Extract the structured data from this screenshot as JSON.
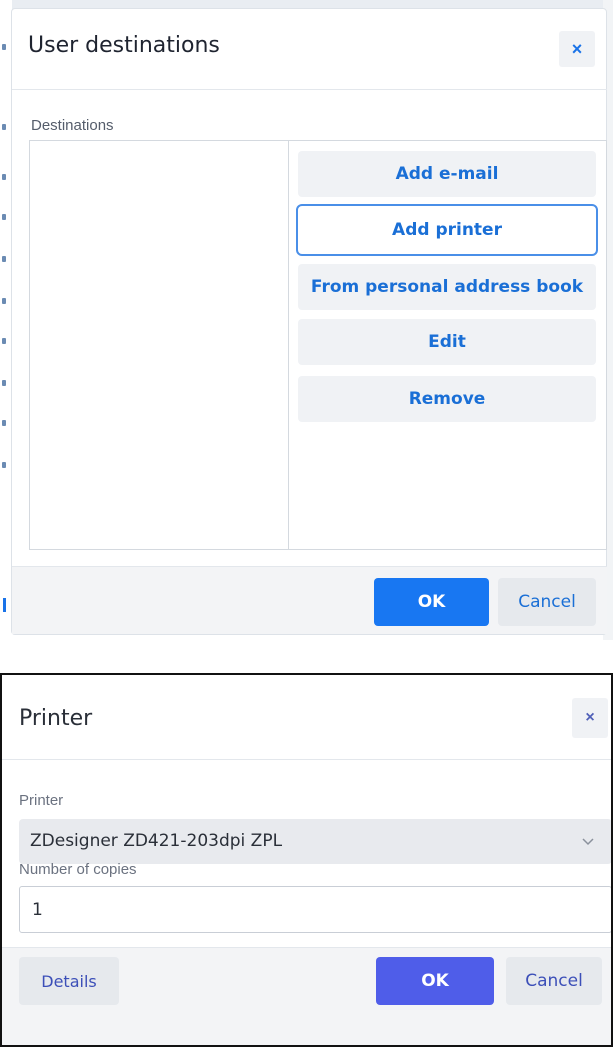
{
  "user_destinations_dialog": {
    "title": "User destinations",
    "close_glyph": "×",
    "destinations_label": "Destinations",
    "buttons": {
      "add_email": "Add e-mail",
      "add_printer": "Add printer",
      "from_address_book": "From personal address book",
      "edit": "Edit",
      "remove": "Remove"
    },
    "footer": {
      "ok": "OK",
      "cancel": "Cancel"
    }
  },
  "printer_dialog": {
    "title": "Printer",
    "close_glyph": "×",
    "printer_label": "Printer",
    "printer_selected": "ZDesigner ZD421-203dpi ZPL",
    "copies_label": "Number of copies",
    "copies_value": "1",
    "footer": {
      "details": "Details",
      "ok": "OK",
      "cancel": "Cancel"
    }
  },
  "icons": {
    "close": "close-icon",
    "dropdown": "chevron-down-icon"
  },
  "colors": {
    "primary_blue": "#1877f2",
    "link_blue": "#1a6fd6",
    "printer_ok": "#4f5de9",
    "printer_link": "#3c4fb8"
  }
}
